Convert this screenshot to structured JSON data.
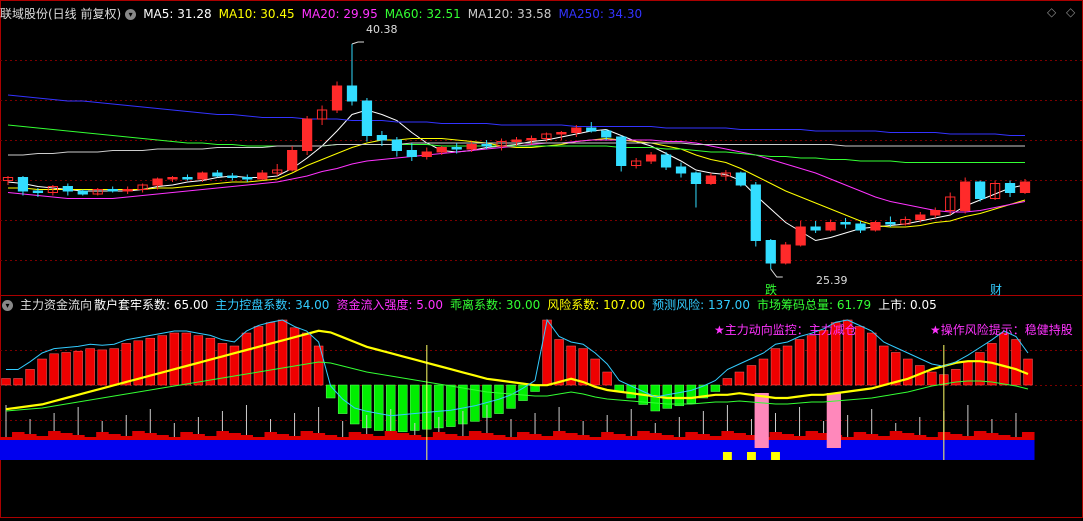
{
  "main_header": {
    "title": "联域股份(日线 前复权)",
    "ma": [
      {
        "label": "MA5: 31.28",
        "color": "#ffffff"
      },
      {
        "label": "MA10: 30.45",
        "color": "#ffff00"
      },
      {
        "label": "MA20: 29.95",
        "color": "#ff33ff"
      },
      {
        "label": "MA60: 32.51",
        "color": "#33ff33"
      },
      {
        "label": "MA120: 33.58",
        "color": "#cccccc"
      },
      {
        "label": "MA250: 34.30",
        "color": "#3333ff"
      }
    ]
  },
  "main_annotations": {
    "high_label": "40.38",
    "low_label": "25.39",
    "tag_left": "跌",
    "tag_right": "财"
  },
  "sub_header": {
    "title": "主力资金流向",
    "items": [
      {
        "label": "散户套牢系数: 65.00",
        "color": "#ffffff"
      },
      {
        "label": "主力控盘系数: 34.00",
        "color": "#33ccff"
      },
      {
        "label": "资金流入强度: 5.00",
        "color": "#ff33ff"
      },
      {
        "label": "乖离系数: 30.00",
        "color": "#33ff33"
      },
      {
        "label": "风险系数: 107.00",
        "color": "#ffff00"
      },
      {
        "label": "预测风险: 137.00",
        "color": "#33ccff"
      },
      {
        "label": "市场筹码总量: 61.79",
        "color": "#33ff33"
      },
      {
        "label": "上市: 0.05",
        "color": "#ffffff"
      }
    ]
  },
  "sub_annotations": {
    "monitor": "★主力动向监控：主力减仓",
    "risk_tip": "★操作风险提示：稳健持股"
  },
  "colors": {
    "up": "#ff2a2a",
    "down": "#33ddff",
    "grid": "#7a0000",
    "border": "#aa0000"
  },
  "chart_data": {
    "type": "candlestick",
    "price_range": [
      24,
      42
    ],
    "candles": [
      [
        31.3,
        31.6,
        31.0,
        31.5
      ],
      [
        31.5,
        31.6,
        30.3,
        30.6
      ],
      [
        30.6,
        30.8,
        30.2,
        30.5
      ],
      [
        30.5,
        31.0,
        30.3,
        30.9
      ],
      [
        30.9,
        31.1,
        30.3,
        30.6
      ],
      [
        30.6,
        30.7,
        30.3,
        30.4
      ],
      [
        30.4,
        30.8,
        30.3,
        30.7
      ],
      [
        30.7,
        30.9,
        30.5,
        30.6
      ],
      [
        30.6,
        30.9,
        30.4,
        30.7
      ],
      [
        30.7,
        31.1,
        30.5,
        31.0
      ],
      [
        31.0,
        31.5,
        30.7,
        31.4
      ],
      [
        31.4,
        31.6,
        31.2,
        31.5
      ],
      [
        31.5,
        31.7,
        31.3,
        31.4
      ],
      [
        31.4,
        31.9,
        31.2,
        31.8
      ],
      [
        31.8,
        32.0,
        31.5,
        31.6
      ],
      [
        31.6,
        31.8,
        31.3,
        31.5
      ],
      [
        31.5,
        31.7,
        31.2,
        31.4
      ],
      [
        31.4,
        32.0,
        31.3,
        31.8
      ],
      [
        31.8,
        32.4,
        31.6,
        32.0
      ],
      [
        32.0,
        33.6,
        31.9,
        33.3
      ],
      [
        33.3,
        35.6,
        33.0,
        35.4
      ],
      [
        35.4,
        36.3,
        35.0,
        36.0
      ],
      [
        36.0,
        37.9,
        35.8,
        37.6
      ],
      [
        37.6,
        40.4,
        36.3,
        36.6
      ],
      [
        36.6,
        36.8,
        33.9,
        34.3
      ],
      [
        34.3,
        34.6,
        33.6,
        34.0
      ],
      [
        34.0,
        34.2,
        32.9,
        33.3
      ],
      [
        33.3,
        33.8,
        32.6,
        32.9
      ],
      [
        32.9,
        33.5,
        32.7,
        33.2
      ],
      [
        33.2,
        33.6,
        33.0,
        33.5
      ],
      [
        33.5,
        33.8,
        33.1,
        33.4
      ],
      [
        33.4,
        33.9,
        33.2,
        33.7
      ],
      [
        33.7,
        34.0,
        33.4,
        33.6
      ],
      [
        33.6,
        34.1,
        33.3,
        33.9
      ],
      [
        33.9,
        34.2,
        33.6,
        34.0
      ],
      [
        34.0,
        34.3,
        33.7,
        34.1
      ],
      [
        34.1,
        34.5,
        33.9,
        34.4
      ],
      [
        34.4,
        34.6,
        34.0,
        34.5
      ],
      [
        34.5,
        35.0,
        34.2,
        34.8
      ],
      [
        34.8,
        35.2,
        34.5,
        34.6
      ],
      [
        34.6,
        34.7,
        34.0,
        34.2
      ],
      [
        34.2,
        34.3,
        31.9,
        32.3
      ],
      [
        32.3,
        32.8,
        32.1,
        32.6
      ],
      [
        32.6,
        33.2,
        32.4,
        33.0
      ],
      [
        33.0,
        33.2,
        32.0,
        32.2
      ],
      [
        32.2,
        32.5,
        31.5,
        31.8
      ],
      [
        31.8,
        31.9,
        29.5,
        31.1
      ],
      [
        31.1,
        31.8,
        31.0,
        31.6
      ],
      [
        31.6,
        32.0,
        31.3,
        31.8
      ],
      [
        31.8,
        31.9,
        30.9,
        31.0
      ],
      [
        31.0,
        31.2,
        26.9,
        27.3
      ],
      [
        27.3,
        27.4,
        25.4,
        25.8
      ],
      [
        25.8,
        27.2,
        25.7,
        27.0
      ],
      [
        27.0,
        28.6,
        26.9,
        28.2
      ],
      [
        28.2,
        28.6,
        27.8,
        28.0
      ],
      [
        28.0,
        28.7,
        27.9,
        28.5
      ],
      [
        28.5,
        28.8,
        28.1,
        28.4
      ],
      [
        28.4,
        28.6,
        27.8,
        28.0
      ],
      [
        28.0,
        28.6,
        27.9,
        28.5
      ],
      [
        28.5,
        28.9,
        28.2,
        28.4
      ],
      [
        28.4,
        28.9,
        28.3,
        28.7
      ],
      [
        28.7,
        29.2,
        28.5,
        29.0
      ],
      [
        29.0,
        29.5,
        28.8,
        29.3
      ],
      [
        29.3,
        30.5,
        29.0,
        30.2
      ],
      [
        29.3,
        31.5,
        29.1,
        31.2
      ],
      [
        31.2,
        31.3,
        29.9,
        30.1
      ],
      [
        30.1,
        31.3,
        30.0,
        31.1
      ],
      [
        31.1,
        31.3,
        30.2,
        30.5
      ],
      [
        30.5,
        31.4,
        30.4,
        31.2
      ]
    ],
    "ma_series": [
      {
        "name": "MA5",
        "values": [
          31.2,
          31.1,
          30.9,
          30.8,
          30.7,
          30.6,
          30.6,
          30.6,
          30.6,
          30.7,
          30.9,
          31.0,
          31.2,
          31.3,
          31.5,
          31.6,
          31.5,
          31.5,
          31.6,
          32.1,
          32.8,
          33.6,
          34.6,
          35.7,
          36.0,
          35.7,
          35.3,
          34.5,
          33.8,
          33.3,
          33.2,
          33.3,
          33.5,
          33.6,
          33.7,
          33.9,
          34.0,
          34.2,
          34.4,
          34.6,
          34.7,
          34.3,
          33.9,
          33.6,
          33.1,
          32.6,
          32.0,
          31.8,
          31.7,
          31.3,
          30.3,
          29.4,
          28.5,
          27.9,
          27.3,
          27.5,
          27.8,
          28.1,
          28.2,
          28.3,
          28.4,
          28.6,
          28.8,
          29.0,
          29.6,
          30.0,
          30.4,
          30.8,
          31.0
        ]
      },
      {
        "name": "MA10",
        "values": [
          30.8,
          30.8,
          30.7,
          30.7,
          30.7,
          30.7,
          30.7,
          30.7,
          30.7,
          30.7,
          30.8,
          30.8,
          30.9,
          31.0,
          31.1,
          31.2,
          31.2,
          31.3,
          31.4,
          31.8,
          32.3,
          32.7,
          33.1,
          33.5,
          33.8,
          34.0,
          34.0,
          34.1,
          34.1,
          34.1,
          34.0,
          33.9,
          33.8,
          33.6,
          33.5,
          33.5,
          33.6,
          33.7,
          33.9,
          34.0,
          34.1,
          34.0,
          33.9,
          33.8,
          33.6,
          33.4,
          33.0,
          32.7,
          32.5,
          32.1,
          31.6,
          31.1,
          30.6,
          30.2,
          29.8,
          29.4,
          29.0,
          28.6,
          28.3,
          28.2,
          28.2,
          28.3,
          28.5,
          28.6,
          28.9,
          29.1,
          29.4,
          29.7,
          30.0
        ]
      },
      {
        "name": "MA20",
        "values": [
          30.5,
          30.4,
          30.3,
          30.2,
          30.1,
          30.1,
          30.1,
          30.1,
          30.2,
          30.3,
          30.4,
          30.5,
          30.6,
          30.7,
          30.8,
          30.9,
          31.0,
          31.1,
          31.2,
          31.4,
          31.6,
          31.9,
          32.1,
          32.4,
          32.6,
          32.7,
          32.8,
          32.9,
          33.0,
          33.1,
          33.2,
          33.3,
          33.4,
          33.5,
          33.6,
          33.7,
          33.8,
          33.8,
          33.9,
          34.0,
          34.0,
          34.0,
          34.0,
          34.0,
          33.9,
          33.9,
          33.8,
          33.6,
          33.4,
          33.2,
          33.0,
          32.7,
          32.4,
          32.1,
          31.8,
          31.4,
          31.0,
          30.6,
          30.2,
          29.9,
          29.7,
          29.5,
          29.3,
          29.2,
          29.2,
          29.3,
          29.5,
          29.7,
          29.9
        ]
      },
      {
        "name": "MA60",
        "values": [
          35.0,
          34.9,
          34.8,
          34.7,
          34.6,
          34.5,
          34.4,
          34.3,
          34.2,
          34.1,
          34.0,
          33.9,
          33.8,
          33.8,
          33.7,
          33.7,
          33.6,
          33.6,
          33.6,
          33.6,
          33.6,
          33.6,
          33.7,
          33.7,
          33.7,
          33.7,
          33.7,
          33.7,
          33.7,
          33.6,
          33.6,
          33.6,
          33.6,
          33.6,
          33.6,
          33.6,
          33.6,
          33.6,
          33.6,
          33.6,
          33.6,
          33.5,
          33.5,
          33.5,
          33.4,
          33.4,
          33.3,
          33.2,
          33.2,
          33.1,
          33.0,
          32.9,
          32.9,
          32.8,
          32.8,
          32.7,
          32.7,
          32.6,
          32.6,
          32.6,
          32.5,
          32.5,
          32.5,
          32.5,
          32.5,
          32.5,
          32.5,
          32.5,
          32.5
        ]
      },
      {
        "name": "MA120",
        "values": [
          33.0,
          33.0,
          33.1,
          33.1,
          33.2,
          33.2,
          33.2,
          33.3,
          33.3,
          33.3,
          33.4,
          33.4,
          33.4,
          33.4,
          33.5,
          33.5,
          33.5,
          33.5,
          33.6,
          33.6,
          33.6,
          33.6,
          33.7,
          33.7,
          33.7,
          33.7,
          33.7,
          33.8,
          33.8,
          33.8,
          33.8,
          33.8,
          33.8,
          33.8,
          33.8,
          33.8,
          33.8,
          33.8,
          33.8,
          33.8,
          33.8,
          33.8,
          33.8,
          33.8,
          33.8,
          33.8,
          33.7,
          33.7,
          33.7,
          33.7,
          33.7,
          33.7,
          33.7,
          33.7,
          33.7,
          33.7,
          33.6,
          33.6,
          33.6,
          33.6,
          33.6,
          33.6,
          33.6,
          33.6,
          33.6,
          33.6,
          33.6,
          33.6,
          33.6
        ]
      },
      {
        "name": "MA250",
        "values": [
          37.0,
          36.9,
          36.8,
          36.7,
          36.6,
          36.6,
          36.5,
          36.4,
          36.3,
          36.2,
          36.1,
          36.0,
          35.9,
          35.8,
          35.7,
          35.7,
          35.6,
          35.5,
          35.5,
          35.5,
          35.4,
          35.4,
          35.4,
          35.3,
          35.3,
          35.3,
          35.2,
          35.2,
          35.2,
          35.1,
          35.1,
          35.1,
          35.1,
          35.0,
          35.0,
          35.0,
          35.0,
          35.0,
          34.9,
          34.9,
          34.9,
          34.9,
          34.9,
          34.9,
          34.8,
          34.8,
          34.8,
          34.8,
          34.8,
          34.7,
          34.7,
          34.7,
          34.7,
          34.7,
          34.6,
          34.6,
          34.6,
          34.6,
          34.6,
          34.5,
          34.5,
          34.5,
          34.5,
          34.4,
          34.4,
          34.4,
          34.4,
          34.3,
          34.3
        ]
      }
    ],
    "sub_range": [
      0,
      100
    ],
    "flow_bars": [
      5,
      5,
      12,
      20,
      24,
      25,
      26,
      28,
      27,
      28,
      32,
      34,
      36,
      38,
      40,
      40,
      38,
      36,
      32,
      30,
      40,
      45,
      48,
      50,
      44,
      40,
      30,
      -10,
      -22,
      -30,
      -33,
      -35,
      -37,
      -36,
      -35,
      -34,
      -33,
      -32,
      -30,
      -28,
      -25,
      -22,
      -18,
      -12,
      -5,
      50,
      35,
      30,
      28,
      20,
      10,
      -5,
      -10,
      -15,
      -20,
      -18,
      -16,
      -14,
      -10,
      -5,
      5,
      10,
      15,
      20,
      28,
      30,
      35,
      38,
      42,
      48,
      50,
      45,
      40,
      30,
      25,
      20,
      15,
      10,
      8,
      12,
      18,
      25,
      32,
      40,
      35,
      20
    ],
    "yellow_line": [
      33,
      34,
      35,
      36,
      38,
      40,
      42,
      44,
      46,
      48,
      50,
      52,
      54,
      56,
      58,
      60,
      62,
      64,
      66,
      68,
      70,
      72,
      74,
      76,
      78,
      80,
      82,
      81,
      78,
      75,
      72,
      70,
      68,
      66,
      64,
      62,
      60,
      58,
      56,
      54,
      52,
      51,
      50,
      49,
      48,
      48,
      50,
      52,
      50,
      47,
      45,
      44,
      43,
      42,
      41,
      40,
      40,
      40,
      41,
      42,
      42,
      43,
      42,
      41,
      40,
      40,
      41,
      42,
      42,
      43,
      44,
      45,
      46,
      48,
      50,
      52,
      55,
      58,
      60,
      62,
      63,
      63,
      62,
      60,
      58,
      55
    ]
  }
}
